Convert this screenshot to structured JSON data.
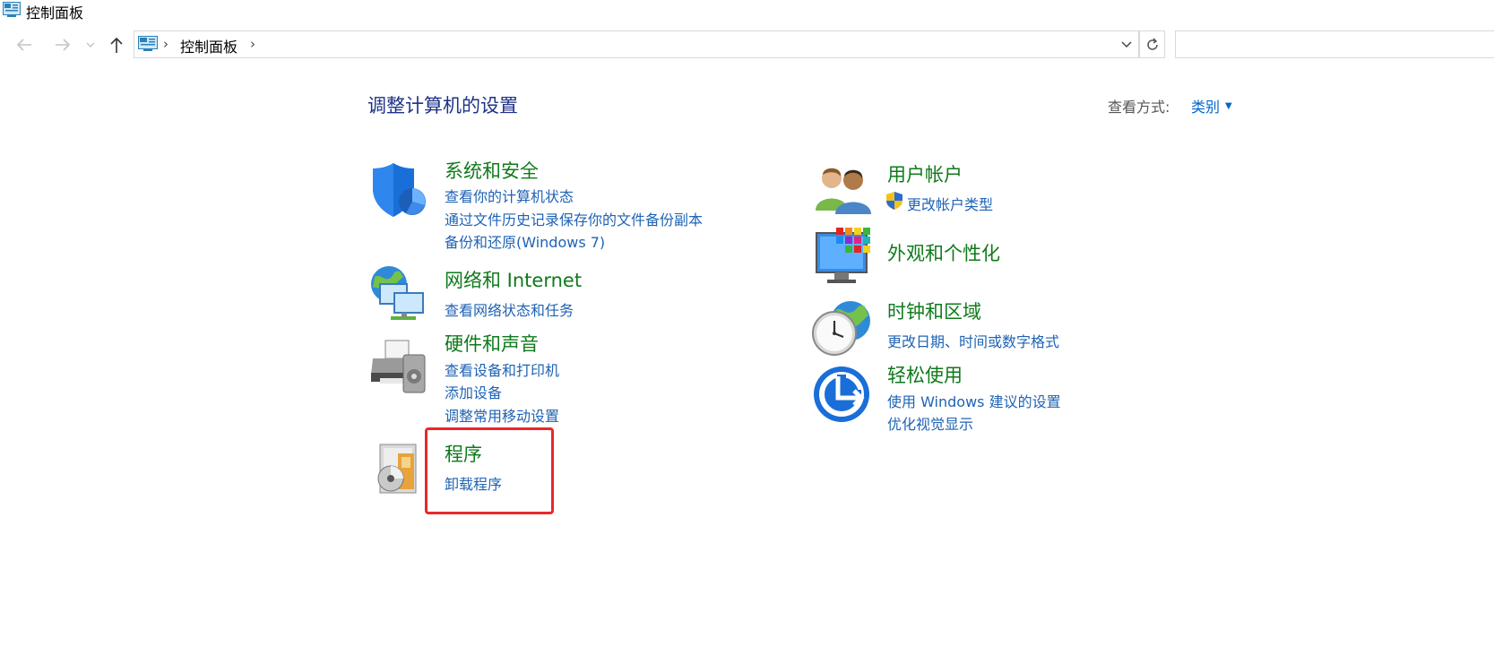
{
  "window": {
    "title": "控制面板"
  },
  "address": {
    "breadcrumb": "控制面板",
    "separator": "›"
  },
  "main": {
    "title": "调整计算机的设置",
    "view_by_label": "查看方式:",
    "view_by_value": "类别",
    "left_categories": [
      {
        "heading": "系统和安全",
        "icon": "shield-icon",
        "links": [
          "查看你的计算机状态",
          "通过文件历史记录保存你的文件备份副本",
          "备份和还原(Windows 7)"
        ]
      },
      {
        "heading": "网络和 Internet",
        "icon": "network-icon",
        "links": [
          "查看网络状态和任务"
        ]
      },
      {
        "heading": "硬件和声音",
        "icon": "printer-icon",
        "links": [
          "查看设备和打印机",
          "添加设备",
          "调整常用移动设置"
        ]
      },
      {
        "heading": "程序",
        "icon": "programs-icon",
        "links": [
          "卸载程序"
        ]
      }
    ],
    "right_categories": [
      {
        "heading": "用户帐户",
        "icon": "users-icon",
        "links": [
          "更改帐户类型"
        ]
      },
      {
        "heading": "外观和个性化",
        "icon": "appearance-icon",
        "links": []
      },
      {
        "heading": "时钟和区域",
        "icon": "clock-icon",
        "links": [
          "更改日期、时间或数字格式"
        ]
      },
      {
        "heading": "轻松使用",
        "icon": "ease-of-access-icon",
        "links": [
          "使用 Windows 建议的设置",
          "优化视觉显示"
        ]
      }
    ]
  },
  "colors": {
    "heading": "#0f7a1b",
    "link": "#1f63b4",
    "title": "#1e3287",
    "highlight": "#e8282b"
  }
}
